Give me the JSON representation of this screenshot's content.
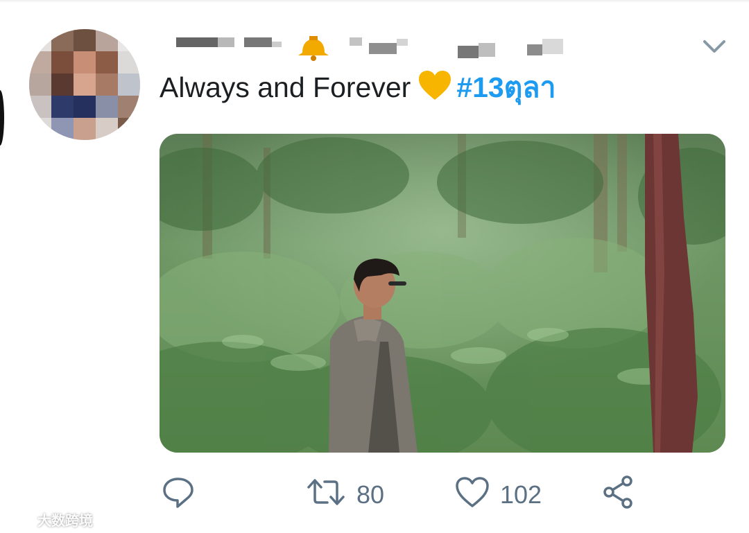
{
  "tweet": {
    "text": "Always and Forever",
    "emoji": "yellow-heart",
    "hashtag": "#13ตุลา"
  },
  "actions": {
    "reply_icon": "reply-icon",
    "retweet_icon": "retweet-icon",
    "retweet_count": "80",
    "like_icon": "heart-icon",
    "like_count": "102",
    "share_icon": "share-icon"
  },
  "colors": {
    "hashtag": "#1d9bf0",
    "action_gray": "#5b7083",
    "text": "#1b1f22",
    "heart_emoji": "#f7b500"
  },
  "watermark": {
    "text": "大数跨境"
  }
}
